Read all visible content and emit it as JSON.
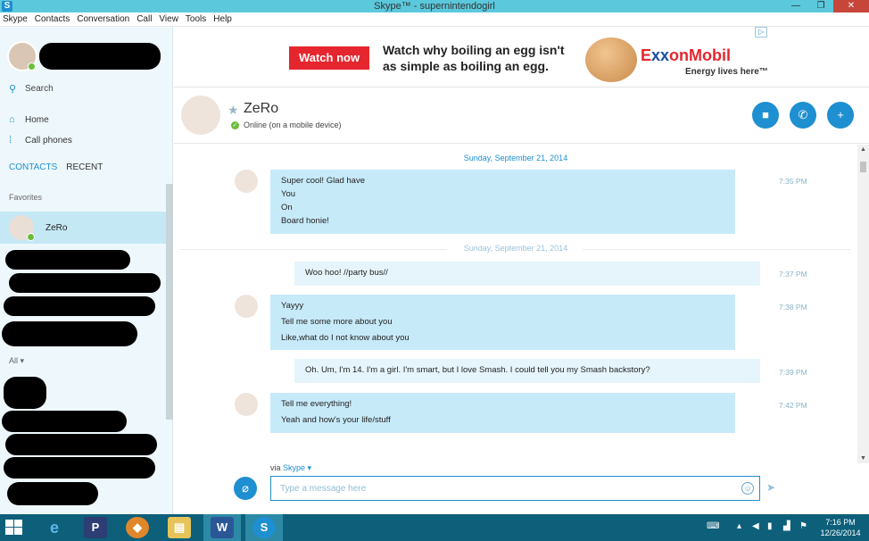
{
  "window": {
    "title": "Skype™ - supernintendogirl",
    "logo": "S"
  },
  "menu": [
    "Skype",
    "Contacts",
    "Conversation",
    "Call",
    "View",
    "Tools",
    "Help"
  ],
  "sidebar": {
    "search_label": "Search",
    "nav": [
      {
        "icon": "home-icon",
        "label": "Home"
      },
      {
        "icon": "dialpad-icon",
        "label": "Call phones"
      }
    ],
    "tabs": {
      "contacts": "CONTACTS",
      "recent": "RECENT"
    },
    "favorites_label": "Favorites",
    "favorite_contact": {
      "name": "ZeRo"
    },
    "all_label": "All ▾"
  },
  "ad": {
    "button": "Watch now",
    "headline_1": "Watch why boiling an egg isn't",
    "headline_2": "as simple as boiling an egg.",
    "brand_pre": "E",
    "brand_x": "xx",
    "brand_post": "onMobil",
    "tagline": "Energy lives here™",
    "choice": "▷"
  },
  "chat": {
    "contact_name": "ZeRo",
    "status": "Online (on a mobile device)",
    "dates": [
      "Sunday, September 21, 2014",
      "Sunday, September 21, 2014"
    ],
    "messages": [
      {
        "direction": "in",
        "lines": [
          "Super cool! Glad have",
          "You",
          "On",
          "Board honie!"
        ],
        "time": "7:35 PM"
      },
      {
        "direction": "out",
        "lines": [
          "Woo hoo! //party bus//"
        ],
        "time": "7:37 PM"
      },
      {
        "direction": "in",
        "lines": [
          "Yayyy",
          "Tell me some more about you",
          "Like,what do I not know about you"
        ],
        "time": "7:38 PM"
      },
      {
        "direction": "out",
        "lines": [
          "Oh. Um, I'm 14. I'm a girl. I'm smart, but I love Smash. I could tell you my Smash backstory?"
        ],
        "time": "7:39 PM"
      },
      {
        "direction": "in",
        "lines": [
          "Tell me everything!",
          "Yeah and how's your life/stuff"
        ],
        "time": "7:42 PM"
      }
    ]
  },
  "composer": {
    "via_prefix": "via ",
    "via_service": "Skype ▾",
    "placeholder": "Type a message here"
  },
  "taskbar": {
    "time": "7:16 PM",
    "date": "12/26/2014"
  },
  "colors": {
    "accent": "#1e8fd0",
    "incoming_bubble": "#c7eaf9",
    "outgoing_bubble": "#e6f5fb",
    "online": "#6bbd3a",
    "taskbar": "#0d5f7a"
  }
}
